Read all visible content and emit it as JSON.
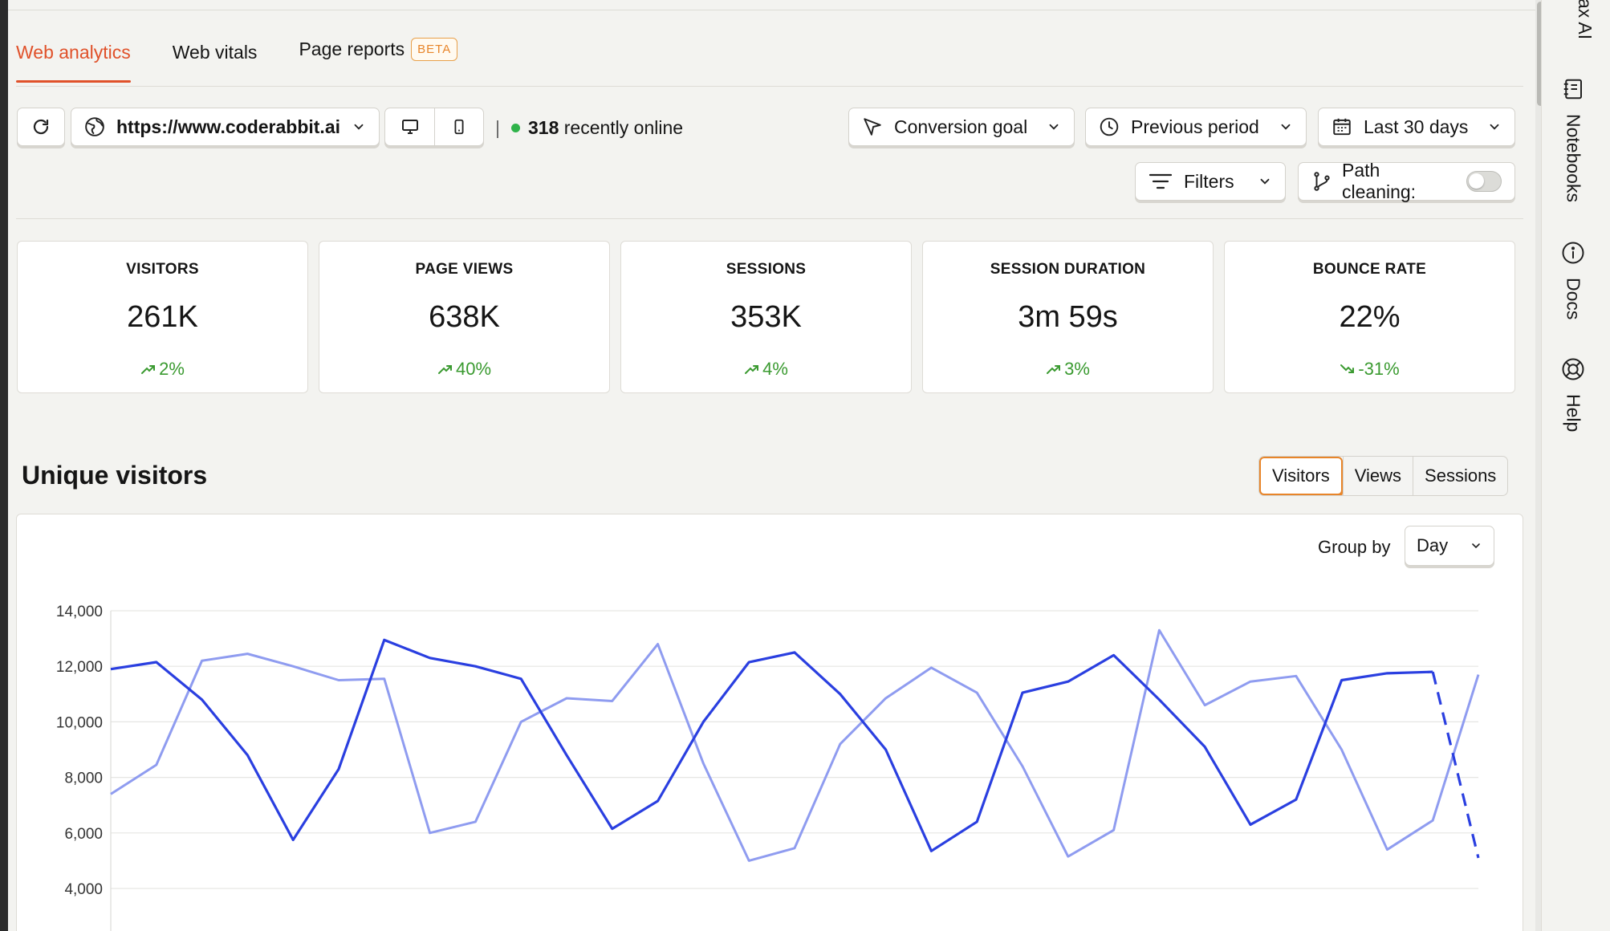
{
  "tabs": [
    {
      "label": "Web analytics",
      "active": true
    },
    {
      "label": "Web vitals",
      "active": false
    },
    {
      "label": "Page reports",
      "badge": "BETA",
      "active": false
    }
  ],
  "toolbar": {
    "domain": "https://www.coderabbit.ai",
    "online_count": "318",
    "online_label": "recently online",
    "conversion_goal": "Conversion goal",
    "comparison": "Previous period",
    "date_range": "Last 30 days",
    "filters": "Filters",
    "path_cleaning": "Path cleaning:",
    "path_cleaning_enabled": false
  },
  "stats": [
    {
      "label": "VISITORS",
      "value": "261K",
      "change": "2%",
      "trend": "up"
    },
    {
      "label": "PAGE VIEWS",
      "value": "638K",
      "change": "40%",
      "trend": "up"
    },
    {
      "label": "SESSIONS",
      "value": "353K",
      "change": "4%",
      "trend": "up"
    },
    {
      "label": "SESSION DURATION",
      "value": "3m 59s",
      "change": "3%",
      "trend": "up"
    },
    {
      "label": "BOUNCE RATE",
      "value": "22%",
      "change": "-31%",
      "trend": "down"
    }
  ],
  "chart_section": {
    "title": "Unique visitors",
    "views": [
      "Visitors",
      "Views",
      "Sessions"
    ],
    "active_view": "Visitors",
    "group_by_label": "Group by",
    "group_by_value": "Day"
  },
  "chart_data": {
    "type": "line",
    "title": "Unique visitors",
    "xlabel": "",
    "ylabel": "",
    "y_ticks": [
      "14,000",
      "12,000",
      "10,000",
      "8,000",
      "6,000",
      "4,000"
    ],
    "y_tick_values": [
      14000,
      12000,
      10000,
      8000,
      6000,
      4000
    ],
    "ylim": [
      4000,
      14000
    ],
    "grid": true,
    "colors": {
      "current": "#2a3fe0",
      "previous": "#8f9cf0"
    },
    "series": [
      {
        "values": [
          11900,
          12150,
          10800,
          8800,
          5750,
          8300,
          12950,
          12300,
          12000,
          11550,
          8800,
          6150,
          7150,
          10000,
          12150,
          12500,
          11000,
          9000,
          5350,
          6400,
          11050,
          11450,
          12400,
          10800,
          9100,
          6300,
          7200,
          11500,
          11750,
          11800,
          5100
        ],
        "last_segment_dashed": true
      },
      {
        "values": [
          7400,
          8450,
          12200,
          12450,
          12000,
          11500,
          11550,
          6000,
          6400,
          10000,
          10850,
          10750,
          12800,
          8500,
          5000,
          5450,
          9200,
          10850,
          11950,
          11050,
          8400,
          5150,
          6100,
          13300,
          10600,
          11450,
          11650,
          9000,
          5400,
          6450,
          11700
        ]
      }
    ]
  },
  "sidebar": {
    "items": [
      "ax AI",
      "Notebooks",
      "Docs",
      "Help"
    ]
  }
}
